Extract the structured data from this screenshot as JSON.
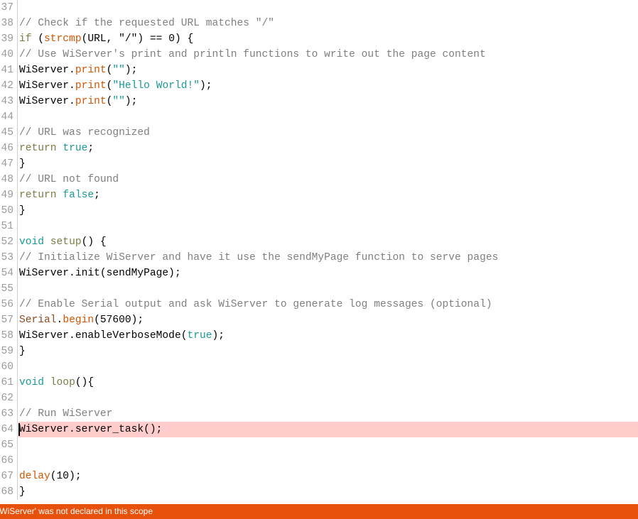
{
  "editor": {
    "language": "arduino-cpp",
    "accent_color": "#1a9a94",
    "highlight_color": "#ffcccc",
    "first_visible_line": 37,
    "cursor_line": 64,
    "lines": [
      {
        "n": "37",
        "tokens": []
      },
      {
        "n": "38",
        "tokens": [
          {
            "t": "// Check if the requested URL matches \"/\"",
            "c": "comment"
          }
        ]
      },
      {
        "n": "39",
        "tokens": [
          {
            "t": "if",
            "c": "keyword"
          },
          {
            "t": " (",
            "c": "punct"
          },
          {
            "t": "strcmp",
            "c": "func"
          },
          {
            "t": "(URL, ",
            "c": "plain"
          },
          {
            "t": "\"/\"",
            "c": "plain"
          },
          {
            "t": ") == 0) {",
            "c": "plain"
          }
        ]
      },
      {
        "n": "40",
        "tokens": [
          {
            "t": "// Use WiServer's print and println functions to write out the page content",
            "c": "comment"
          }
        ]
      },
      {
        "n": "41",
        "tokens": [
          {
            "t": "WiServer.",
            "c": "plain"
          },
          {
            "t": "print",
            "c": "func"
          },
          {
            "t": "(",
            "c": "punct"
          },
          {
            "t": "\"\"",
            "c": "literal"
          },
          {
            "t": ");",
            "c": "punct"
          }
        ]
      },
      {
        "n": "42",
        "tokens": [
          {
            "t": "WiServer.",
            "c": "plain"
          },
          {
            "t": "print",
            "c": "func"
          },
          {
            "t": "(",
            "c": "punct"
          },
          {
            "t": "\"Hello World!\"",
            "c": "literal"
          },
          {
            "t": ");",
            "c": "punct"
          }
        ]
      },
      {
        "n": "43",
        "tokens": [
          {
            "t": "WiServer.",
            "c": "plain"
          },
          {
            "t": "print",
            "c": "func"
          },
          {
            "t": "(",
            "c": "punct"
          },
          {
            "t": "\"\"",
            "c": "literal"
          },
          {
            "t": ");",
            "c": "punct"
          }
        ]
      },
      {
        "n": "44",
        "tokens": []
      },
      {
        "n": "45",
        "tokens": [
          {
            "t": "// URL was recognized",
            "c": "comment"
          }
        ]
      },
      {
        "n": "46",
        "tokens": [
          {
            "t": "return",
            "c": "keyword"
          },
          {
            "t": " ",
            "c": "plain"
          },
          {
            "t": "true",
            "c": "literal"
          },
          {
            "t": ";",
            "c": "punct"
          }
        ]
      },
      {
        "n": "47",
        "tokens": [
          {
            "t": "}",
            "c": "punct"
          }
        ]
      },
      {
        "n": "48",
        "tokens": [
          {
            "t": "// URL not found",
            "c": "comment"
          }
        ]
      },
      {
        "n": "49",
        "tokens": [
          {
            "t": "return",
            "c": "keyword"
          },
          {
            "t": " ",
            "c": "plain"
          },
          {
            "t": "false",
            "c": "literal"
          },
          {
            "t": ";",
            "c": "punct"
          }
        ]
      },
      {
        "n": "50",
        "tokens": [
          {
            "t": "}",
            "c": "punct"
          }
        ]
      },
      {
        "n": "51",
        "tokens": []
      },
      {
        "n": "52",
        "tokens": [
          {
            "t": "void",
            "c": "type"
          },
          {
            "t": " ",
            "c": "plain"
          },
          {
            "t": "setup",
            "c": "keyword"
          },
          {
            "t": "() {",
            "c": "punct"
          }
        ]
      },
      {
        "n": "53",
        "tokens": [
          {
            "t": "// Initialize WiServer and have it use the sendMyPage function to serve pages",
            "c": "comment"
          }
        ]
      },
      {
        "n": "54",
        "tokens": [
          {
            "t": "WiServer.init(sendMyPage);",
            "c": "plain"
          }
        ]
      },
      {
        "n": "55",
        "tokens": []
      },
      {
        "n": "56",
        "tokens": [
          {
            "t": "// Enable Serial output and ask WiServer to generate log messages (optional)",
            "c": "comment"
          }
        ]
      },
      {
        "n": "57",
        "tokens": [
          {
            "t": "Serial",
            "c": "obj"
          },
          {
            "t": ".",
            "c": "punct"
          },
          {
            "t": "begin",
            "c": "func"
          },
          {
            "t": "(57600);",
            "c": "punct"
          }
        ]
      },
      {
        "n": "58",
        "tokens": [
          {
            "t": "WiServer.enableVerboseMode(",
            "c": "plain"
          },
          {
            "t": "true",
            "c": "literal"
          },
          {
            "t": ");",
            "c": "punct"
          }
        ]
      },
      {
        "n": "59",
        "tokens": [
          {
            "t": "}",
            "c": "punct"
          }
        ]
      },
      {
        "n": "60",
        "tokens": []
      },
      {
        "n": "61",
        "tokens": [
          {
            "t": "void",
            "c": "type"
          },
          {
            "t": " ",
            "c": "plain"
          },
          {
            "t": "loop",
            "c": "keyword"
          },
          {
            "t": "(){",
            "c": "punct"
          }
        ]
      },
      {
        "n": "62",
        "tokens": []
      },
      {
        "n": "63",
        "tokens": [
          {
            "t": "// Run WiServer",
            "c": "comment"
          }
        ]
      },
      {
        "n": "64",
        "tokens": [
          {
            "t": "WiServer.server_task();",
            "c": "plain"
          }
        ],
        "highlighted": true,
        "caret": true
      },
      {
        "n": "65",
        "tokens": []
      },
      {
        "n": "66",
        "tokens": []
      },
      {
        "n": "67",
        "tokens": [
          {
            "t": "delay",
            "c": "func"
          },
          {
            "t": "(10);",
            "c": "punct"
          }
        ]
      },
      {
        "n": "68",
        "tokens": [
          {
            "t": "}",
            "c": "punct"
          }
        ]
      }
    ]
  },
  "status_bar": {
    "message": "'WiServer' was not declared in this scope",
    "background_color": "#e8510c",
    "text_color": "#ffffff"
  }
}
